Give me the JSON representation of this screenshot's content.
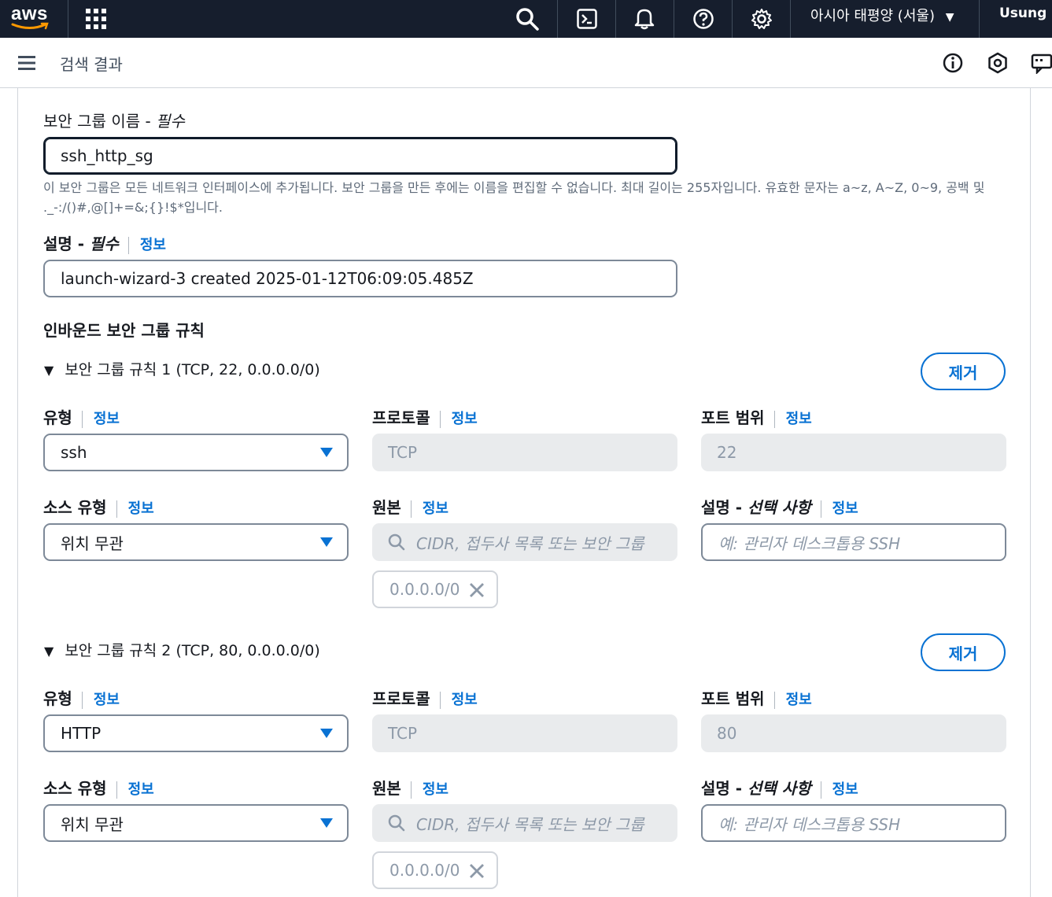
{
  "topnav": {
    "logo": "aws",
    "region": "아시아 태평양 (서울)",
    "user": "Usung",
    "icons": [
      "apps-grid-icon",
      "search-icon",
      "cloudshell-icon",
      "bell-icon",
      "help-icon",
      "gear-icon"
    ]
  },
  "subheader": {
    "breadcrumb": "검색 결과",
    "icons": [
      "menu-icon",
      "info-circle-icon",
      "hexagon-icon",
      "feedback-icon"
    ]
  },
  "form": {
    "name_label": "보안 그룹 이름 - ",
    "name_required": "필수",
    "name_value": "ssh_http_sg",
    "name_hint": "이 보안 그룹은 모든 네트워크 인터페이스에 추가됩니다. 보안 그룹을 만든 후에는 이름을 편집할 수 없습니다. 최대 길이는 255자입니다. 유효한 문자는 a~z, A~Z, 0~9, 공백 및 ._-:/()#,@[]+=&;{}!$*입니다.",
    "desc_label": "설명 - ",
    "desc_required": "필수",
    "info": "정보",
    "desc_value": "launch-wizard-3 created 2025-01-12T06:09:05.485Z",
    "inbound_title": "인바운드 보안 그룹 규칙"
  },
  "labels": {
    "type": "유형",
    "protocol": "프로토콜",
    "port_range": "포트 범위",
    "source_type": "소스 유형",
    "source": "원본",
    "desc_optional_a": "설명 - ",
    "desc_optional_b": "선택 사항",
    "remove": "제거",
    "source_placeholder": "CIDR, 접두사 목록 또는 보안 그룹",
    "desc_placeholder": "예: 관리자 데스크톱용 SSH"
  },
  "rules": [
    {
      "title": "보안 그룹 규칙 1 (TCP, 22, 0.0.0.0/0)",
      "type": "ssh",
      "protocol": "TCP",
      "port": "22",
      "source_type": "위치 무관",
      "cidr": "0.0.0.0/0"
    },
    {
      "title": "보안 그룹 규칙 2 (TCP, 80, 0.0.0.0/0)",
      "type": "HTTP",
      "protocol": "TCP",
      "port": "80",
      "source_type": "위치 무관",
      "cidr": "0.0.0.0/0"
    }
  ],
  "colors": {
    "nav_bg": "#161e2d",
    "link": "#0972d3",
    "caret": "#0972d3"
  }
}
